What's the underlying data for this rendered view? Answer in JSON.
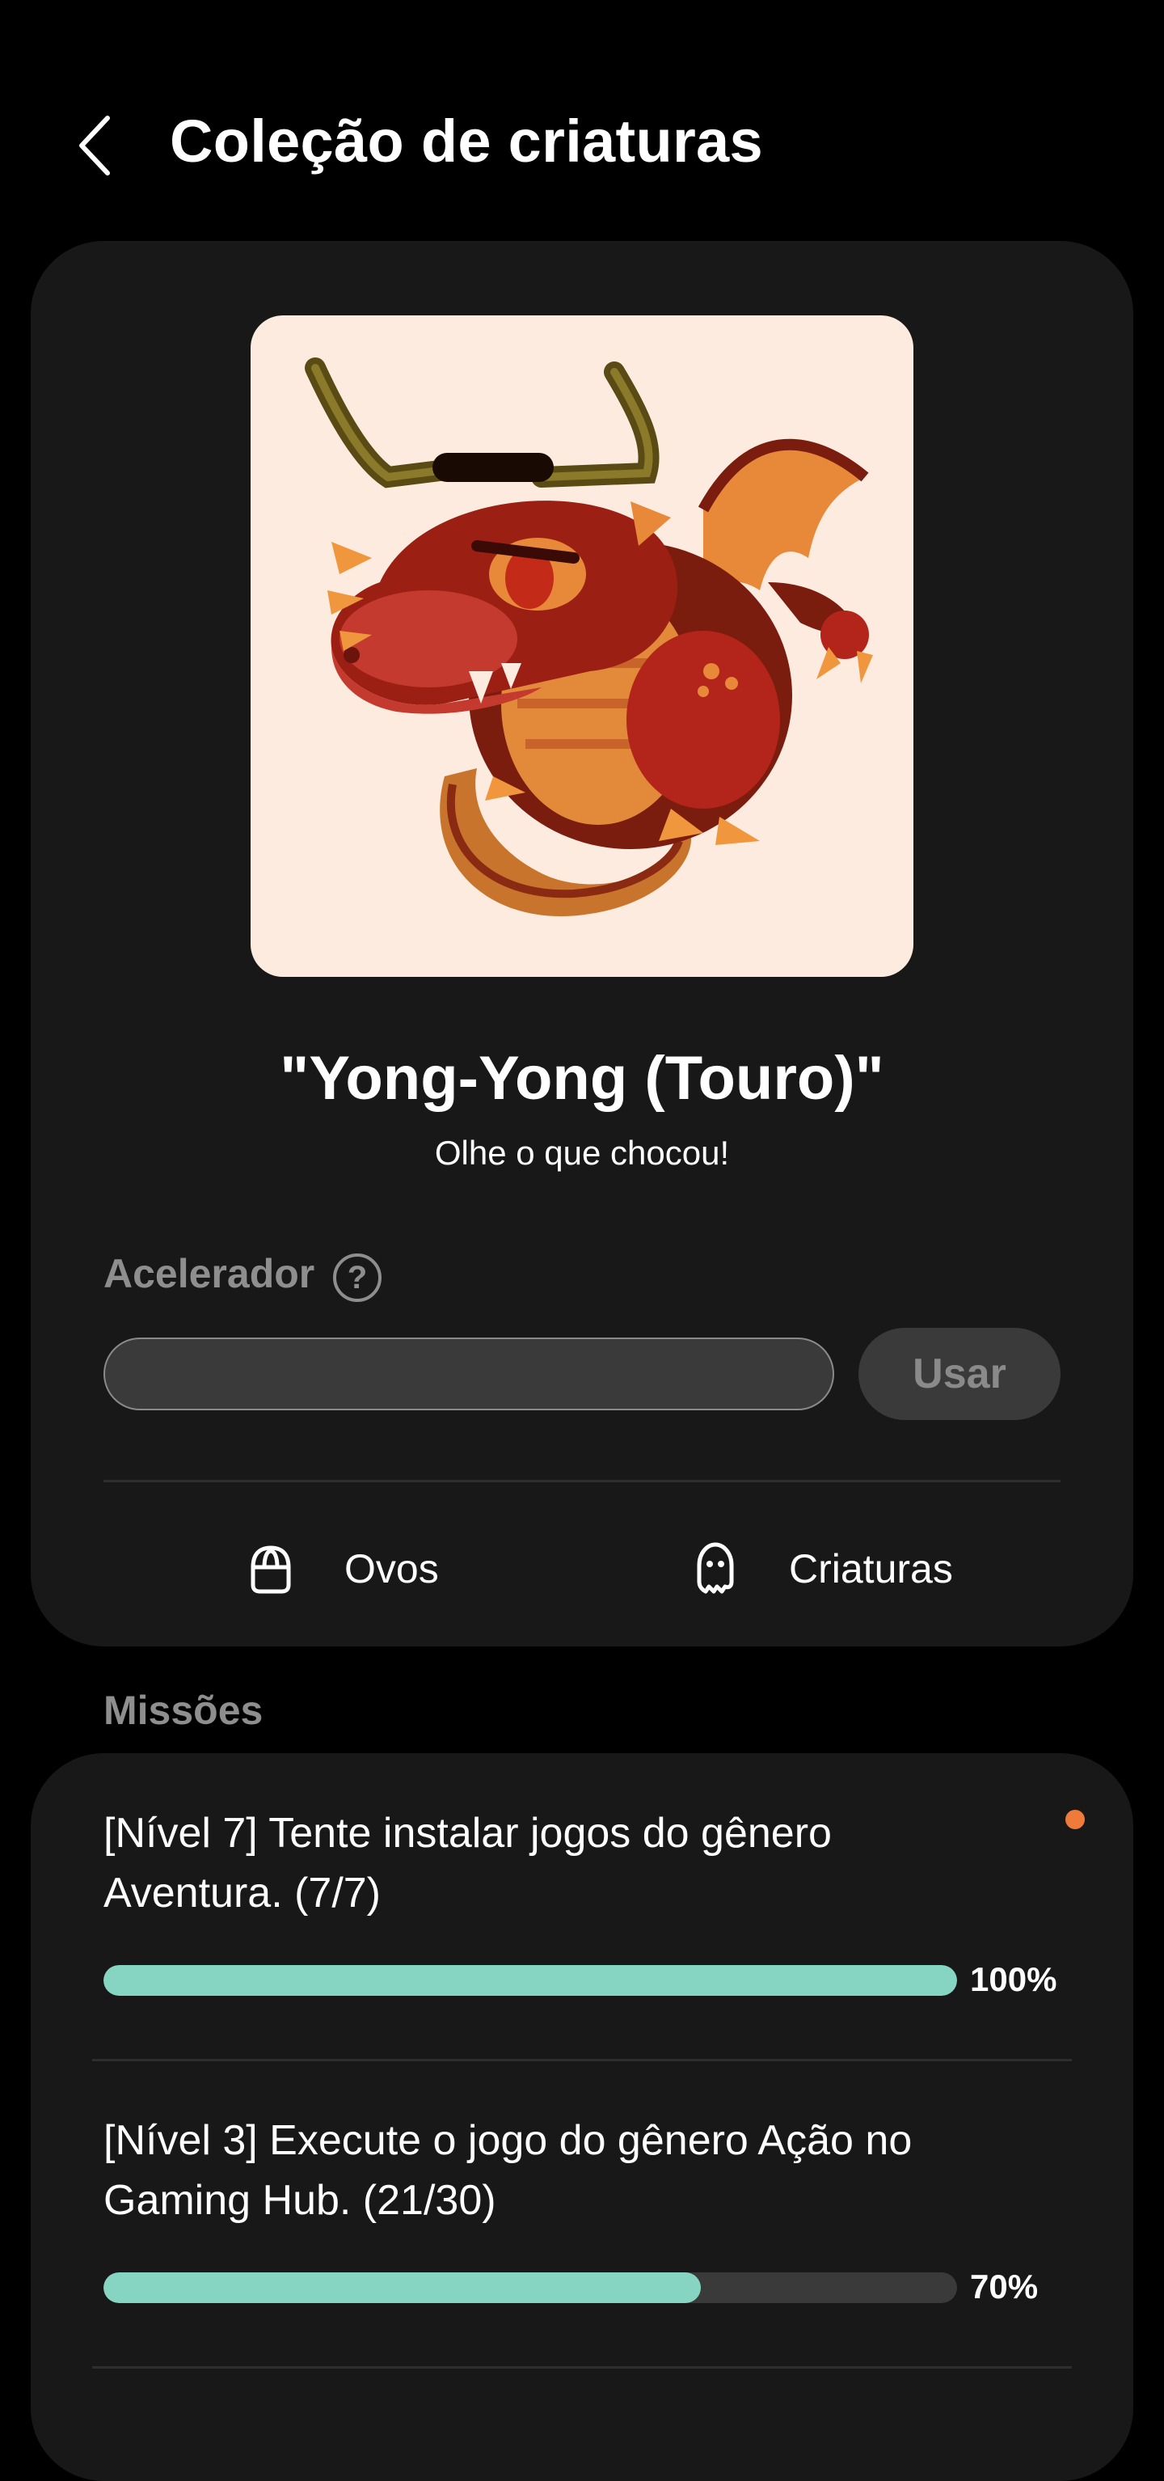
{
  "header": {
    "back_icon": "chevron-left-icon",
    "title": "Coleção de criaturas"
  },
  "creature": {
    "image_icon": "dragon-bull-illustration",
    "name": "\"Yong-Yong (Touro)\"",
    "subtitle": "Olhe o que chocou!"
  },
  "accelerator": {
    "label": "Acelerador",
    "help_icon": "question-circle-icon",
    "help_glyph": "?",
    "input_value": "",
    "input_placeholder": "",
    "use_label": "Usar"
  },
  "tabs": [
    {
      "label": "Ovos",
      "icon": "egg-basket-icon"
    },
    {
      "label": "Criaturas",
      "icon": "ghost-icon"
    }
  ],
  "missions": {
    "section_label": "Missões",
    "items": [
      {
        "text": "[Nível 7]  Tente instalar jogos do gênero Aventura. (7/7)",
        "progress": 1.0,
        "percent_label": "100%",
        "has_new_dot": true
      },
      {
        "text": "[Nível 3]  Execute o jogo do gênero Ação no Gaming Hub. (21/30)",
        "progress": 0.7,
        "percent_label": "70%",
        "has_new_dot": false
      }
    ]
  },
  "colors": {
    "background": "#000000",
    "card": "#181818",
    "progress_fill": "#86d5c2",
    "progress_track": "#3a3a3a",
    "notification_dot": "#f07a3a",
    "muted_text": "#8e8e8e"
  }
}
